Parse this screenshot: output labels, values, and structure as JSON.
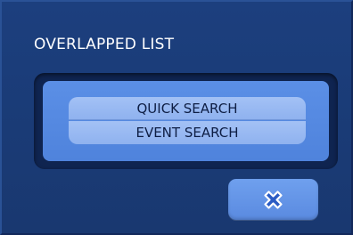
{
  "dialog": {
    "title": "OVERLAPPED LIST",
    "list": {
      "items": [
        {
          "label": "QUICK SEARCH"
        },
        {
          "label": "EVENT SEARCH"
        }
      ]
    },
    "close_button": {
      "icon": "close-icon"
    }
  },
  "colors": {
    "dialog_background": "#1c3f7e",
    "list_well": "#0f2450",
    "list_panel": "#5b8fe6",
    "list_item": "#a3c1f5",
    "close_button": "#6fa0ee",
    "title_text": "#ffffff"
  }
}
